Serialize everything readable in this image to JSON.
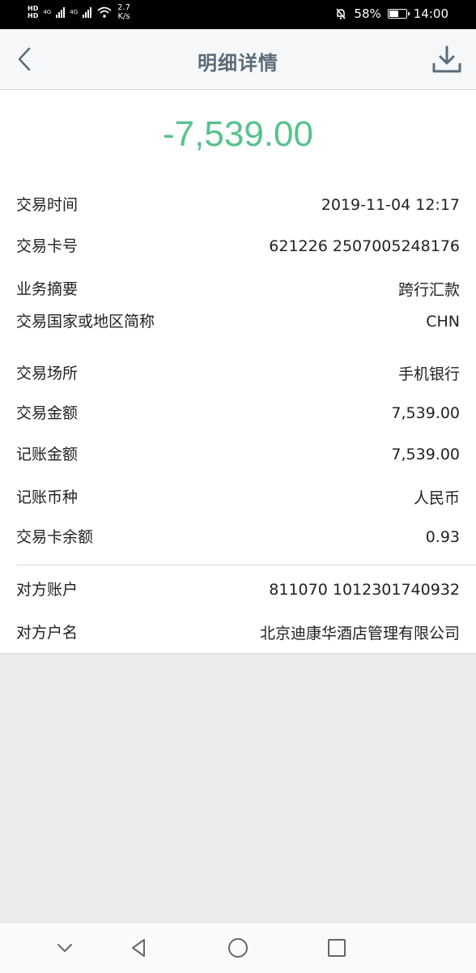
{
  "status_bar": {
    "hd1": "HD",
    "hd2": "HD",
    "net1": "4G",
    "net2": "4G",
    "speed_value": "2.7",
    "speed_unit": "K/s",
    "battery_percent": "58%",
    "battery_level": 0.58,
    "time": "14:00"
  },
  "header": {
    "title": "明细详情",
    "icons": [
      "back-arrow-icon",
      "download-icon"
    ]
  },
  "transaction": {
    "amount": "-7,539.00",
    "amount_color": "#56c28c",
    "details": [
      {
        "label": "交易时间",
        "value": "2019-11-04 12:17"
      },
      {
        "label": "交易卡号",
        "value": "621226 2507005248176"
      },
      {
        "label": "业务摘要",
        "value": "跨行汇款"
      },
      {
        "label": "交易国家或地区简称",
        "value": "CHN"
      },
      {
        "label": "交易场所",
        "value": "手机银行"
      },
      {
        "label": "交易金额",
        "value": "7,539.00"
      },
      {
        "label": "记账金额",
        "value": "7,539.00"
      },
      {
        "label": "记账币种",
        "value": "人民币"
      },
      {
        "label": "交易卡余额",
        "value": "0.93"
      }
    ],
    "counterparty": [
      {
        "label": "对方账户",
        "value": "811070 1012301740932"
      },
      {
        "label": "对方户名",
        "value": "北京迪康华酒店管理有限公司"
      }
    ]
  },
  "nav_bar": {
    "icons": [
      "chevron-down-icon",
      "back-triangle-icon",
      "home-circle-icon",
      "recents-square-icon"
    ]
  }
}
